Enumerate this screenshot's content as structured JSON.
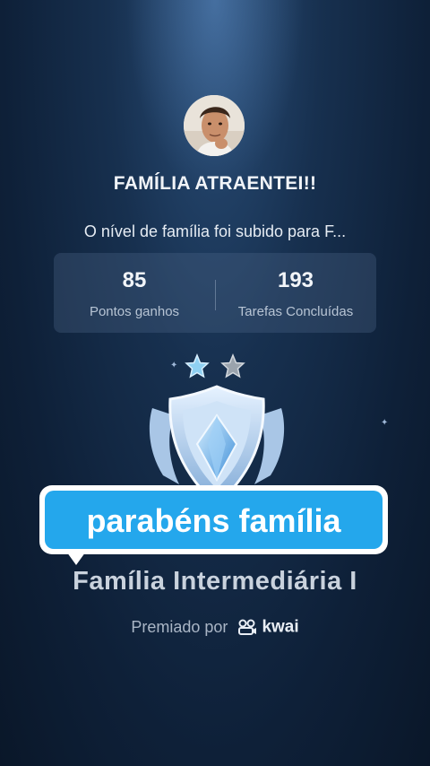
{
  "group": {
    "name": "FAMÍLIA ATRAENTEI!!",
    "message": "O nível de família foi subido para F..."
  },
  "stats": [
    {
      "value": "85",
      "label": "Pontos ganhos"
    },
    {
      "value": "193",
      "label": "Tarefas Concluídas"
    }
  ],
  "stars": {
    "filled": 1,
    "total": 2
  },
  "banner": {
    "text": "parabéns família"
  },
  "level": {
    "name": "Família Intermediária I"
  },
  "award": {
    "prefix": "Premiado por",
    "brand": "kwai"
  },
  "colors": {
    "banner": "#24a7ec",
    "background": "#0e2038",
    "star_filled": "#8fd0f2",
    "star_empty": "#9aa3ad"
  }
}
